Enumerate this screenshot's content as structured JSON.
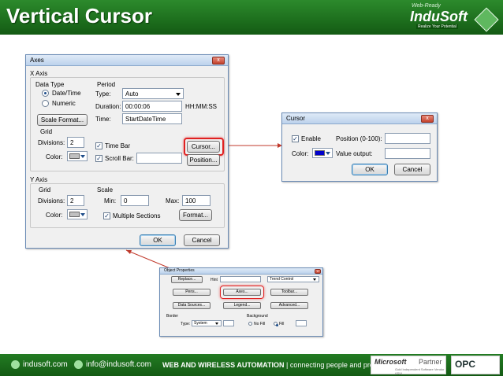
{
  "slide": {
    "title": "Vertical Cursor",
    "logo": {
      "tag": "Web-Ready",
      "brand": "InduSoft",
      "slogan": "Realize Your Potential"
    },
    "footer": {
      "site": "indusoft.com",
      "email": "info@indusoft.com",
      "tagline_bold": "WEB AND WIRELESS AUTOMATION",
      "tagline_rest": "| connecting people and process",
      "partner": {
        "ms": "Microsoft",
        "partner": "Partner",
        "small": "Gold Independent Software Vendor (ISV)"
      },
      "opc": "OPC"
    }
  },
  "axes_dialog": {
    "title": "Axes",
    "close": "x",
    "x_axis": {
      "group_label": "X Axis",
      "data_type_label": "Data Type",
      "options": [
        "Date/Time",
        "Numeric"
      ],
      "selected": "Date/Time",
      "scale_format_button": "Scale Format...",
      "period": {
        "label": "Period",
        "type_label": "Type:",
        "type_value": "Auto",
        "duration_label": "Duration:",
        "duration_value": "00:00:06",
        "duration_unit": "HH:MM:SS",
        "time_label": "Time:",
        "time_value": "StartDateTime"
      },
      "grid": {
        "label": "Grid",
        "divisions_label": "Divisions:",
        "divisions_value": "2",
        "color_label": "Color:"
      },
      "time_bar_label": "Time Bar",
      "scroll_bar_label": "Scroll Bar:",
      "cursor_button": "Cursor...",
      "position_button": "Position..."
    },
    "y_axis": {
      "group_label": "Y Axis",
      "grid": {
        "label": "Grid",
        "divisions_label": "Divisions:",
        "divisions_value": "2",
        "color_label": "Color:"
      },
      "scale": {
        "label": "Scale",
        "min_label": "Min:",
        "min_value": "0",
        "max_label": "Max:",
        "max_value": "100",
        "multiple_sections_label": "Multiple Sections",
        "format_button": "Format..."
      }
    },
    "ok_button": "OK",
    "cancel_button": "Cancel"
  },
  "cursor_dialog": {
    "title": "Cursor",
    "close": "x",
    "enable_label": "Enable",
    "color_label": "Color:",
    "color": "#0000cc",
    "position_label": "Position (0-100):",
    "output_label": "Value output:",
    "ok_button": "OK",
    "cancel_button": "Cancel"
  },
  "object_properties": {
    "title": "Object Properties",
    "replace_button": "Replace...",
    "hint_label": "Hint",
    "type_value": "Trend Control",
    "buttons": [
      "Pens...",
      "Axes...",
      "Toolbar...",
      "Data Sources...",
      "Legend...",
      "Advanced..."
    ],
    "border_label": "Border",
    "border_type_label": "Type:",
    "border_type_value": "System",
    "background_label": "Background",
    "no_fill_label": "No Fill",
    "fill_label": "Fill"
  },
  "colors": {
    "header_green": "#1d6e1d",
    "highlight_red": "#e02020",
    "connector_red": "#c0392b"
  }
}
